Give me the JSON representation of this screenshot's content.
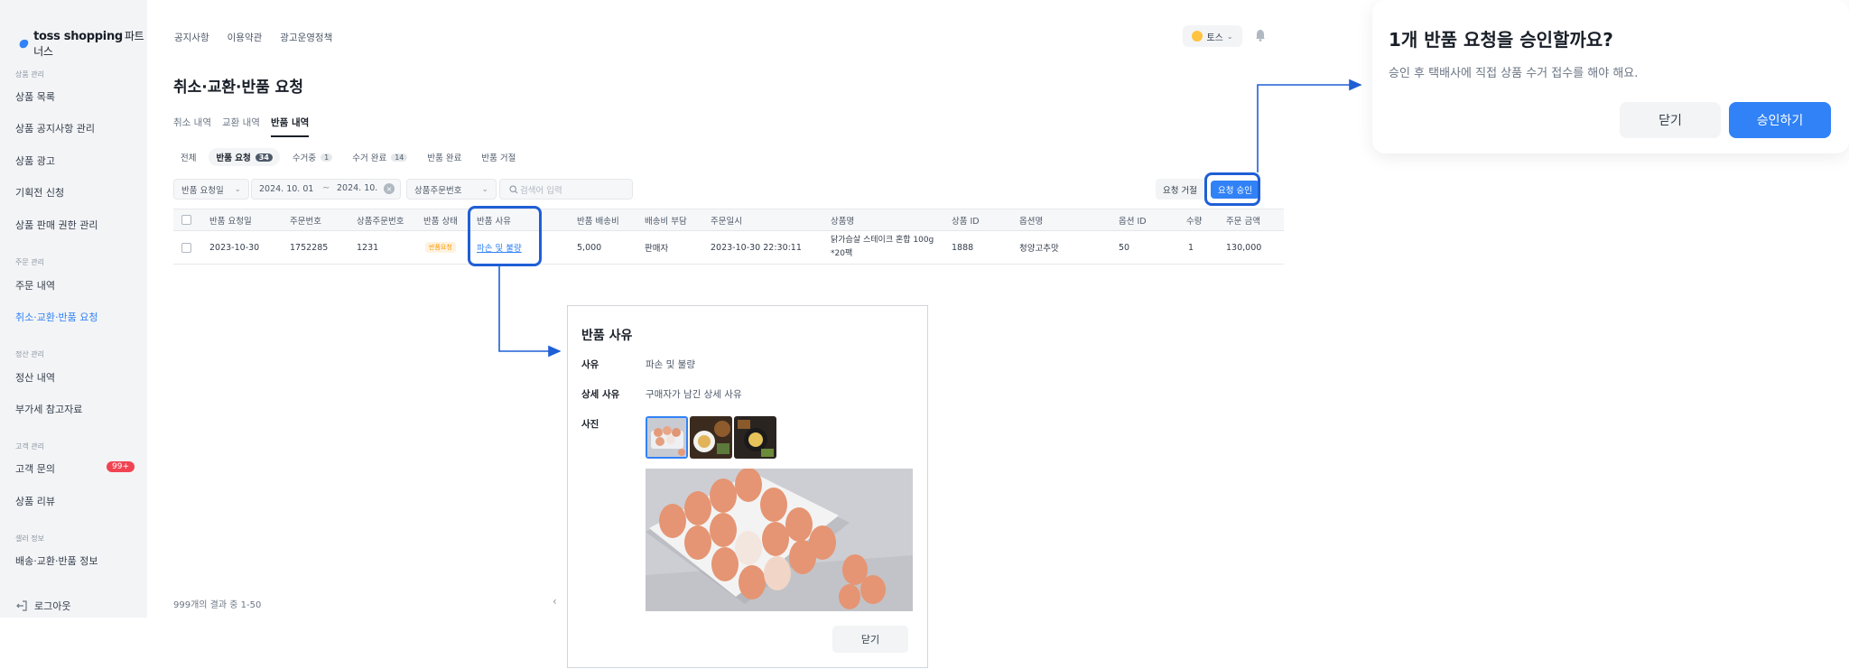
{
  "app": {
    "logo_main": "toss shopping",
    "logo_sub": "파트너스",
    "brand_color": "#3182f6"
  },
  "topnav": [
    "공지사항",
    "이용약관",
    "광고운영정책"
  ],
  "user": {
    "name": "토스"
  },
  "sidebar": {
    "sections": [
      {
        "label": "상품 관리",
        "items": [
          "상품 목록",
          "상품 공지사항 관리",
          "상품 광고",
          "기획전 신청",
          "상품 판매 권한 관리"
        ]
      },
      {
        "label": "주문 관리",
        "items": [
          "주문 내역",
          "취소·교환·반품 요청"
        ]
      },
      {
        "label": "정산 관리",
        "items": [
          "정산 내역",
          "부가세 참고자료"
        ]
      },
      {
        "label": "고객 관리",
        "items": [
          "고객 문의",
          "상품 리뷰"
        ]
      },
      {
        "label": "셀러 정보",
        "items": [
          "배송·교환·반품 정보"
        ]
      }
    ],
    "inquiry_badge": "99+",
    "logout": "로그아웃"
  },
  "page": {
    "title": "취소·교환·반품 요청",
    "tabs": [
      "취소 내역",
      "교환 내역",
      "반품 내역"
    ],
    "status_filters": [
      {
        "label": "전체",
        "count": ""
      },
      {
        "label": "반품 요청",
        "count": "34"
      },
      {
        "label": "수거중",
        "count": "1"
      },
      {
        "label": "수거 완료",
        "count": "14"
      },
      {
        "label": "반품 완료",
        "count": ""
      },
      {
        "label": "반품 거절",
        "count": ""
      }
    ],
    "date_type": "반품 요청일",
    "date_from": "2024. 10. 01",
    "date_sep": "~",
    "date_to": "2024. 10.",
    "search_type": "상품주문번호",
    "search_placeholder": "검색어 입력",
    "reject_button": "요청 거절",
    "approve_button": "요청 승인"
  },
  "table": {
    "headers": [
      "반품 요청일",
      "주문번호",
      "상품주문번호",
      "반품 상태",
      "반품 사유",
      "반품 배송비",
      "배송비 부담",
      "주문일시",
      "상품명",
      "상품 ID",
      "옵션명",
      "옵션 ID",
      "수량",
      "주문 금액"
    ],
    "rows": [
      {
        "date": "2023-10-30",
        "order_no": "1752285",
        "product_order_no": "1231",
        "status": "반품요청",
        "reason": "파손 및 불량",
        "shipping_fee": "5,000",
        "fee_payer": "판매자",
        "ordered_at": "2023-10-30 22:30:11",
        "product_name_1": "닭가슴살 스테이크 혼합 100g",
        "product_name_2": "*20팩",
        "product_id": "1888",
        "option_name": "청양고추맛",
        "option_id": "50",
        "qty": "1",
        "amount": "130,000"
      }
    ],
    "result_text": "999개의 결과 중 1-50",
    "prev_icon": "chevron-left-icon"
  },
  "reason_popup": {
    "title": "반품 사유",
    "reason_label": "사유",
    "reason_value": "파손 및 불량",
    "detail_label": "상세 사유",
    "detail_value": "구매자가 남긴 상세 사유",
    "photo_label": "사진",
    "close": "닫기"
  },
  "confirm_dialog": {
    "title": "1개 반품 요청을 승인할까요?",
    "description": "승인 후 택배사에 직접 상품 수거 접수를 해야 해요.",
    "cancel": "닫기",
    "confirm": "승인하기"
  },
  "annotation_color": "#1f5fd6"
}
